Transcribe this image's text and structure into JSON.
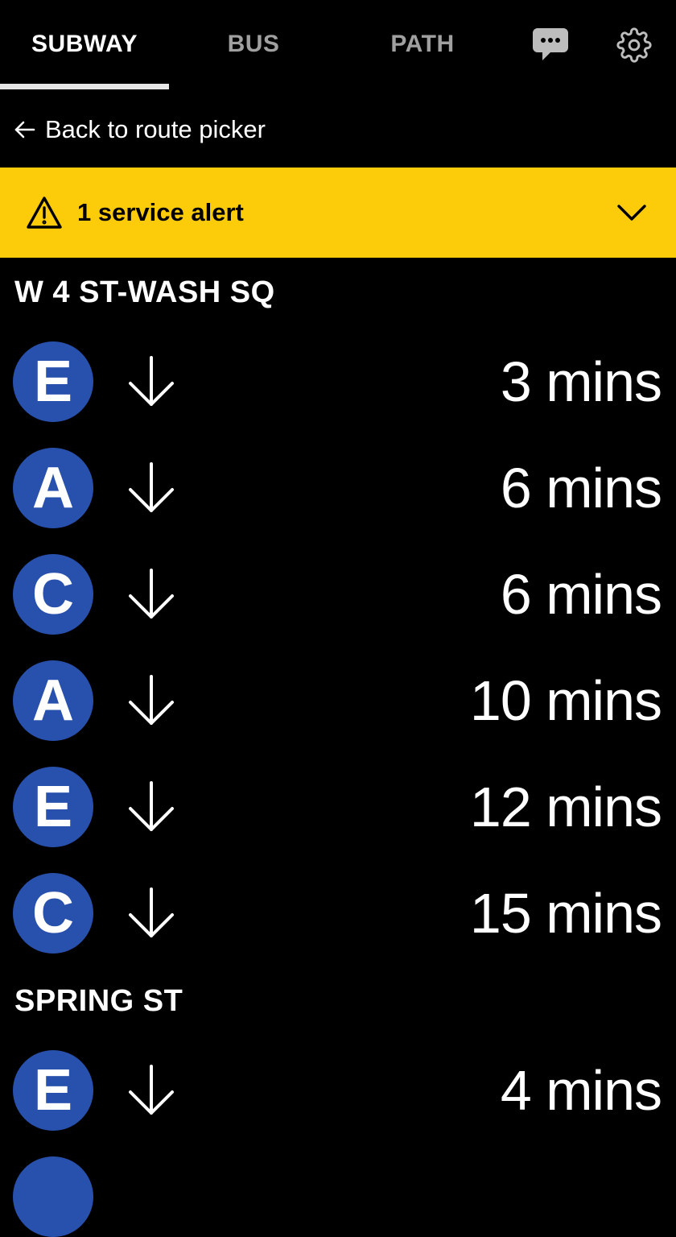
{
  "nav": {
    "tabs": [
      {
        "label": "SUBWAY",
        "active": true
      },
      {
        "label": "BUS",
        "active": false
      },
      {
        "label": "PATH",
        "active": false
      }
    ],
    "feedback_icon": "chat-bubble-icon",
    "settings_icon": "gear-icon"
  },
  "back": {
    "label": "Back to route picker",
    "icon": "arrow-left-icon"
  },
  "alert": {
    "text": "1 service alert",
    "icon": "warning-triangle-icon",
    "expand_icon": "chevron-down-icon",
    "background_color": "#fccc0a"
  },
  "colors": {
    "route_bullet": "#2850ad",
    "background": "#000000"
  },
  "stations": [
    {
      "name": "W 4 ST-WASH SQ",
      "arrivals": [
        {
          "route": "E",
          "direction": "down",
          "time": "3 mins"
        },
        {
          "route": "A",
          "direction": "down",
          "time": "6 mins"
        },
        {
          "route": "C",
          "direction": "down",
          "time": "6 mins"
        },
        {
          "route": "A",
          "direction": "down",
          "time": "10 mins"
        },
        {
          "route": "E",
          "direction": "down",
          "time": "12 mins"
        },
        {
          "route": "C",
          "direction": "down",
          "time": "15 mins"
        }
      ]
    },
    {
      "name": "SPRING ST",
      "arrivals": [
        {
          "route": "E",
          "direction": "down",
          "time": "4 mins"
        }
      ]
    }
  ]
}
